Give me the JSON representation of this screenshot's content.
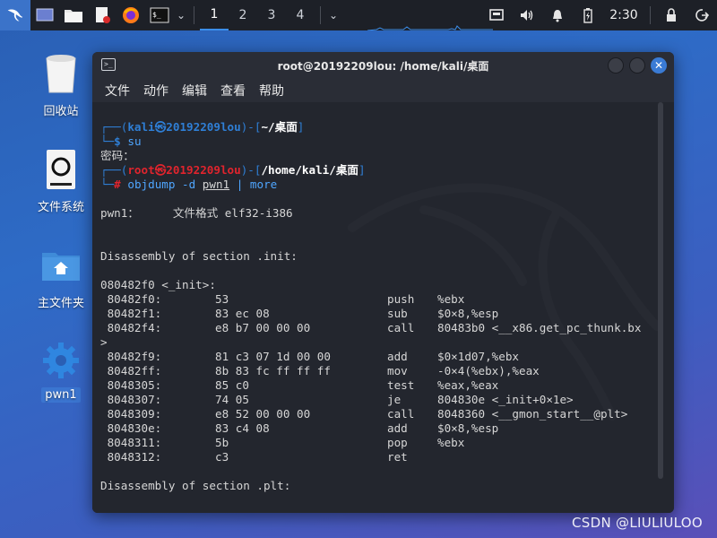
{
  "panel": {
    "workspaces": [
      "1",
      "2",
      "3",
      "4"
    ],
    "active_workspace": "1",
    "clock": "2:30"
  },
  "desktop": {
    "icons": [
      {
        "label": "回收站"
      },
      {
        "label": "文件系统"
      },
      {
        "label": "主文件夹"
      },
      {
        "label": "pwn1"
      }
    ]
  },
  "window": {
    "title": "root@20192209lou: /home/kali/桌面",
    "menu": [
      "文件",
      "动作",
      "编辑",
      "查看",
      "帮助"
    ]
  },
  "terminal": {
    "prompt1": {
      "user": "kali",
      "at": "㉿",
      "host": "20192209lou",
      "path": "~/桌面",
      "symbol": "$",
      "command": "su"
    },
    "password_line": "密码：",
    "prompt2": {
      "user": "root",
      "at": "㉿",
      "host": "20192209lou",
      "path": "/home/kali/桌面",
      "symbol": "#",
      "cmd": "objdump",
      "opt": "-d",
      "arg": "pwn1",
      "pipe": "|",
      "pager": "more"
    },
    "file_format_line": "pwn1：     文件格式 elf32-i386",
    "section_init": "Disassembly of section .init:",
    "func_header": "080482f0 <_init>:",
    "asm": [
      {
        "addr": " 80482f0:",
        "bytes": "53",
        "op": "push",
        "args": "%ebx"
      },
      {
        "addr": " 80482f1:",
        "bytes": "83 ec 08",
        "op": "sub",
        "args": "$0×8,%esp"
      },
      {
        "addr": " 80482f4:",
        "bytes": "e8 b7 00 00 00",
        "op": "call",
        "args": "80483b0 <__x86.get_pc_thunk.bx"
      },
      {
        "addr": ">",
        "bytes": "",
        "op": "",
        "args": ""
      },
      {
        "addr": " 80482f9:",
        "bytes": "81 c3 07 1d 00 00",
        "op": "add",
        "args": "$0×1d07,%ebx"
      },
      {
        "addr": " 80482ff:",
        "bytes": "8b 83 fc ff ff ff",
        "op": "mov",
        "args": "-0×4(%ebx),%eax"
      },
      {
        "addr": " 8048305:",
        "bytes": "85 c0",
        "op": "test",
        "args": "%eax,%eax"
      },
      {
        "addr": " 8048307:",
        "bytes": "74 05",
        "op": "je",
        "args": "804830e <_init+0×1e>"
      },
      {
        "addr": " 8048309:",
        "bytes": "e8 52 00 00 00",
        "op": "call",
        "args": "8048360 <__gmon_start__@plt>"
      },
      {
        "addr": " 804830e:",
        "bytes": "83 c4 08",
        "op": "add",
        "args": "$0×8,%esp"
      },
      {
        "addr": " 8048311:",
        "bytes": "5b",
        "op": "pop",
        "args": "%ebx"
      },
      {
        "addr": " 8048312:",
        "bytes": "c3",
        "op": "ret",
        "args": ""
      }
    ],
    "section_plt": "Disassembly of section .plt:"
  },
  "watermark": "CSDN @LIULIULOO",
  "colors": {
    "panel_bg": "#1d2027",
    "accent": "#3b73c9",
    "terminal_bg": "#23262e",
    "prompt_blue": "#2f7fd6",
    "prompt_red": "#e0242d"
  }
}
